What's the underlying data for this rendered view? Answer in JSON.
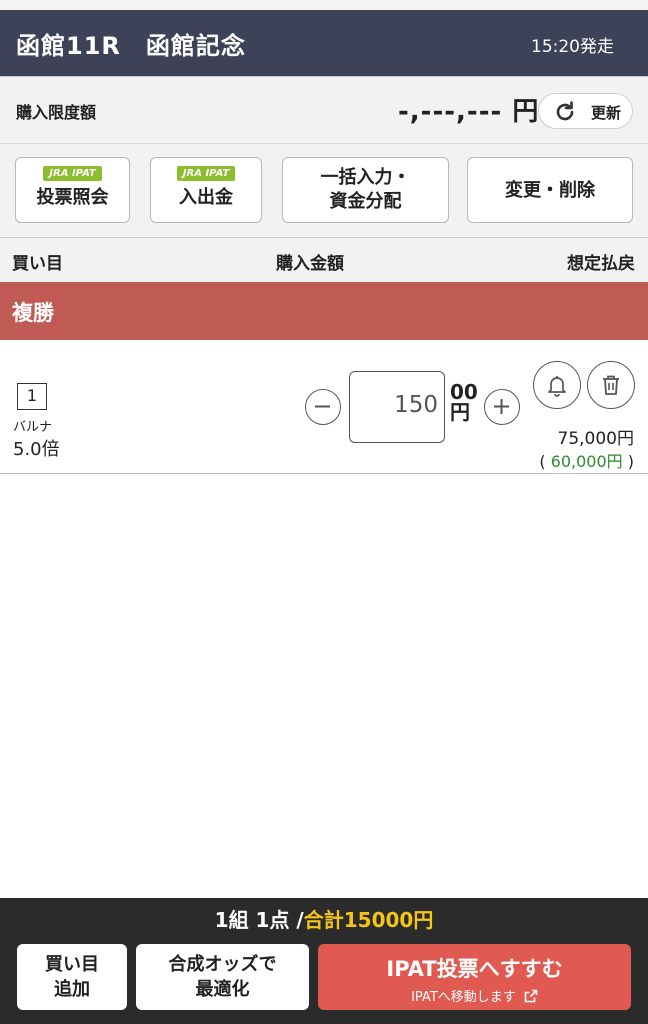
{
  "header": {
    "title": "函館11R　函館記念",
    "post_time": "15:20発走"
  },
  "limit": {
    "label": "購入限度額",
    "amount": "-,---,--- 円",
    "refresh_label": "更新"
  },
  "toolbar": {
    "vote_inquiry": {
      "badge": "JRA IPAT",
      "label": "投票照会"
    },
    "deposit": {
      "badge": "JRA IPAT",
      "label": "入出金"
    },
    "bulk_input": {
      "line1": "一括入力・",
      "line2": "資金分配"
    },
    "change_delete": {
      "label": "変更・削除"
    }
  },
  "columns": {
    "bet": "買い目",
    "amount": "購入金額",
    "payout": "想定払戻"
  },
  "section": {
    "label": "複勝"
  },
  "bets": [
    {
      "number": "1",
      "horse": "バルナ",
      "odds": "5.0倍",
      "amount": "150",
      "unit_top": "00",
      "unit_bottom": "円",
      "payout": "75,000円",
      "payout_paren_open": "(",
      "payout_min": "60,000円",
      "payout_paren_close": ")"
    }
  ],
  "footer": {
    "summary_prefix": "1組 1点 /",
    "summary_total": "合計15000円",
    "add_bet": {
      "line1": "買い目",
      "line2": "追加"
    },
    "optimize": {
      "line1": "合成オッズで",
      "line2": "最適化"
    },
    "ipat": {
      "main": "IPAT投票へすすむ",
      "sub": "IPATへ移動します"
    }
  },
  "colors": {
    "header_bg": "#3e4259",
    "section_bg": "#c05a55",
    "ipat_button": "#e15a52",
    "badge_green": "#8cbd2f",
    "total_yellow": "#f5c518",
    "payout_green": "#2e8b2e"
  }
}
